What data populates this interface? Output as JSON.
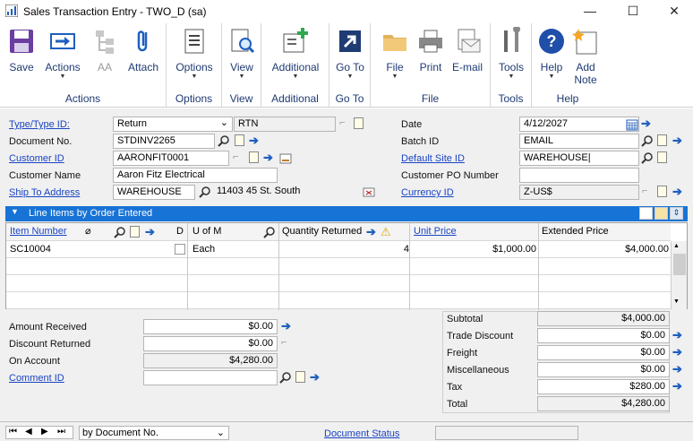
{
  "window": {
    "title": "Sales Transaction Entry  -  TWO_D (sa)",
    "minimize": "—",
    "maximize": "☐",
    "close": "✕"
  },
  "ribbon": {
    "groups": [
      {
        "label": "Actions",
        "buttons": [
          "Save",
          "Actions",
          "AA",
          "Attach"
        ]
      },
      {
        "label": "Options",
        "buttons": [
          "Options"
        ]
      },
      {
        "label": "View",
        "buttons": [
          "View"
        ]
      },
      {
        "label": "Additional",
        "buttons": [
          "Additional"
        ]
      },
      {
        "label": "Go To",
        "buttons": [
          "Go To"
        ]
      },
      {
        "label": "File",
        "buttons": [
          "File",
          "Print",
          "E-mail"
        ]
      },
      {
        "label": "Tools",
        "buttons": [
          "Tools"
        ]
      },
      {
        "label": "Help",
        "buttons": [
          "Help",
          "Add Note"
        ]
      }
    ]
  },
  "form": {
    "type_label": "Type/Type ID:",
    "type_value": "Return",
    "type_id": "RTN",
    "docno_label": "Document No.",
    "docno_value": "STDINV2265",
    "customer_id_label": "Customer ID",
    "customer_id_value": "AARONFIT0001",
    "customer_name_label": "Customer Name",
    "customer_name_value": "Aaron Fitz Electrical",
    "ship_to_label": "Ship To Address",
    "ship_to_value": "WAREHOUSE",
    "ship_to_address": "11403 45 St. South",
    "date_label": "Date",
    "date_value": "4/12/2027",
    "batch_label": "Batch ID",
    "batch_value": "EMAIL",
    "site_label": "Default Site ID",
    "site_value": "WAREHOUSE|",
    "po_label": "Customer PO Number",
    "po_value": "",
    "currency_label": "Currency ID",
    "currency_value": "Z-US$"
  },
  "grid": {
    "title": "Line Items by Order Entered",
    "headers": {
      "item": "Item Number",
      "d": "D",
      "uom": "U of M",
      "qty": "Quantity Returned",
      "price": "Unit Price",
      "ext": "Extended Price"
    },
    "rows": [
      {
        "item": "SC10004",
        "uom": "Each",
        "qty": "4",
        "price": "$1,000.00",
        "ext": "$4,000.00"
      }
    ]
  },
  "left_totals": {
    "amount_received_label": "Amount Received",
    "amount_received": "$0.00",
    "discount_returned_label": "Discount Returned",
    "discount_returned": "$0.00",
    "on_account_label": "On Account",
    "on_account": "$4,280.00",
    "comment_label": "Comment ID",
    "comment_value": ""
  },
  "right_totals": {
    "subtotal_label": "Subtotal",
    "subtotal": "$4,000.00",
    "trade_label": "Trade Discount",
    "trade": "$0.00",
    "freight_label": "Freight",
    "freight": "$0.00",
    "misc_label": "Miscellaneous",
    "misc": "$0.00",
    "tax_label": "Tax",
    "tax": "$280.00",
    "total_label": "Total",
    "total": "$4,280.00"
  },
  "statusbar": {
    "sort": "by Document No.",
    "doc_status": "Document Status"
  },
  "colors": {
    "accent": "#1773d6",
    "link": "#1a44c4",
    "ribbon_text": "#1f3b73"
  }
}
